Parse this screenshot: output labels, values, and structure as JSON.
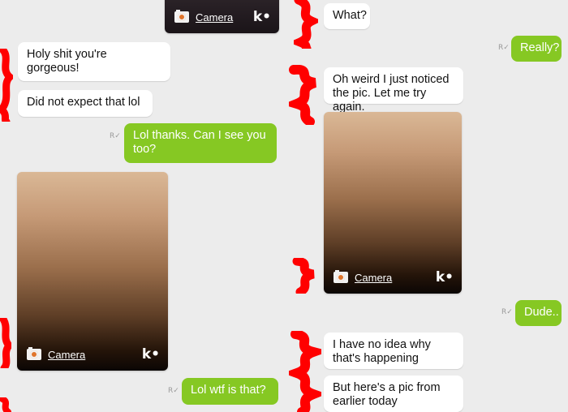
{
  "left": {
    "top_photo": {
      "label": "Camera",
      "logo": "k•"
    },
    "messages": [
      {
        "text": "Holy shit you're gorgeous!"
      },
      {
        "text": "Did not expect that lol"
      },
      {
        "text": "Lol thanks. Can I see you too?"
      },
      {
        "text": "Lol wtf is that?"
      }
    ],
    "photo": {
      "label": "Camera",
      "logo": "k•"
    },
    "receipt": "R✓"
  },
  "right": {
    "messages": [
      {
        "text": "What?"
      },
      {
        "text": "Really?"
      },
      {
        "text": "Oh weird I just noticed the pic. Let me try again."
      },
      {
        "text": "Dude.."
      },
      {
        "text": "I have no idea why that's happening"
      },
      {
        "text": "But here's a pic from earlier today"
      }
    ],
    "photo": {
      "label": "Camera",
      "logo": "k•"
    },
    "receipt": "R✓"
  },
  "colors": {
    "background": "#ececec",
    "incoming_bubble": "#ffffff",
    "outgoing_bubble": "#86c823",
    "redaction": "#ff0000"
  },
  "icons": [
    "camera-icon",
    "kik-logo-icon",
    "read-receipt-icon"
  ]
}
